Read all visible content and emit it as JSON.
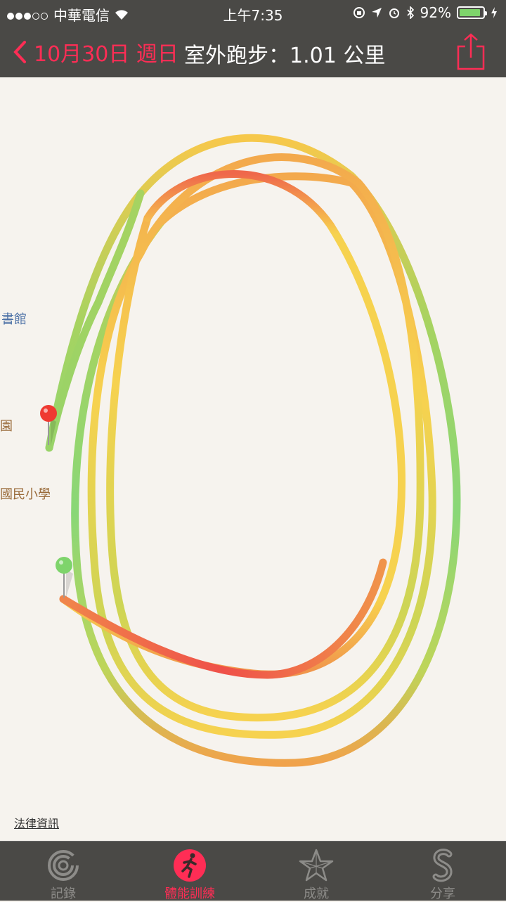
{
  "status": {
    "carrier": "中華電信",
    "time": "上午7:35",
    "battery_pct": "92%",
    "battery_level": 0.92
  },
  "nav": {
    "back_label": "10月30日 週日",
    "title": "室外跑步：1.01 公里"
  },
  "map": {
    "poi": [
      "書館",
      "園",
      "國民小學"
    ],
    "legal": "法律資訊"
  },
  "tabs": [
    {
      "label": "記錄",
      "icon": "rings-icon",
      "active": false
    },
    {
      "label": "體能訓練",
      "icon": "runner-icon",
      "active": true
    },
    {
      "label": "成就",
      "icon": "star-icon",
      "active": false
    },
    {
      "label": "分享",
      "icon": "share-s-icon",
      "active": false
    }
  ],
  "colors": {
    "accent": "#ff2d55",
    "bar": "#4a4946",
    "map_bg": "#f6f3ee",
    "pace_fast": "#7ed46b",
    "pace_mid": "#f7cf3e",
    "pace_slow": "#ef4a3a"
  }
}
